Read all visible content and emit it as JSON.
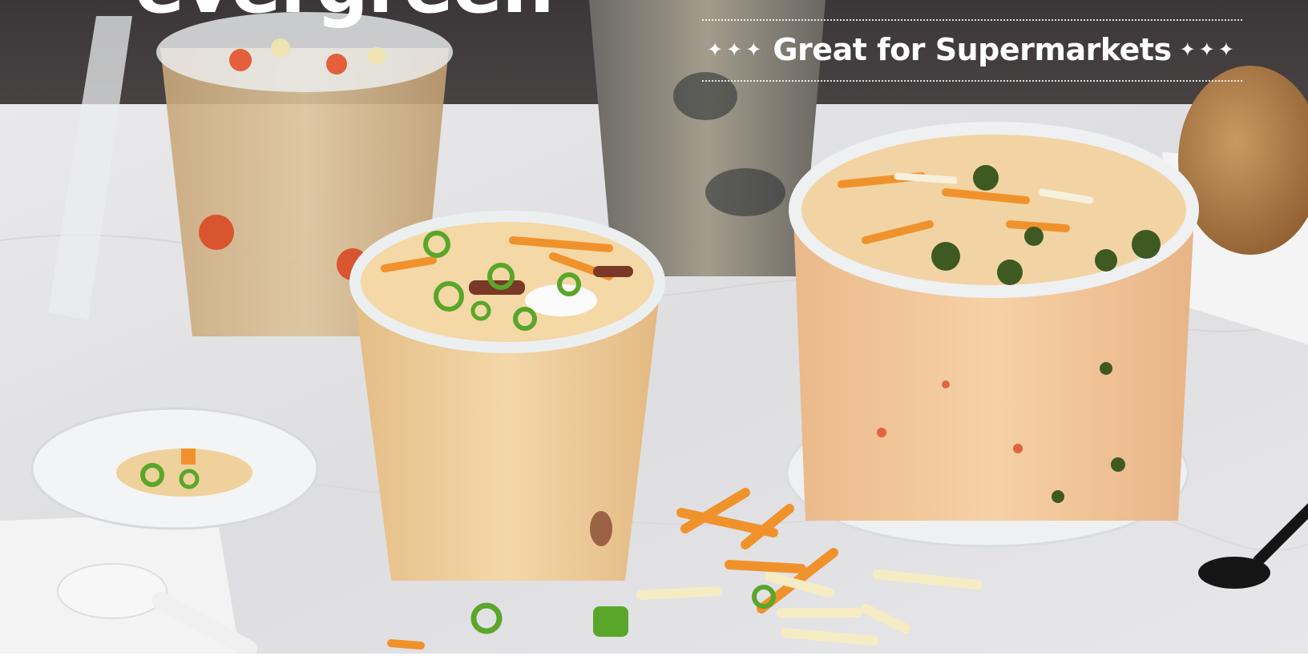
{
  "brand": {
    "wordmark": "evergreen"
  },
  "banner": {
    "title": "Great for Supermarkets",
    "left_ornament": "✦✦✦",
    "right_ornament": "✦✦✦"
  },
  "colors": {
    "wall": "#3a3536",
    "marble": "#e6e6e8",
    "potato_soup": "#f0cf9c",
    "broccoli_soup": "#f2c69a",
    "cheddar": "#f0922c",
    "scallion": "#5aa62a",
    "broccoli": "#3e5a22",
    "text": "#ffffff"
  },
  "scene_objects": [
    "chicken-noodle-soup-container",
    "dark-broccoli-soup-container",
    "loaded-potato-soup-container",
    "broccoli-cheddar-soup-container",
    "clear-lid-with-garnish",
    "stacked-lids",
    "white-plastic-spoon",
    "black-plastic-spoon",
    "bread-roll",
    "towel"
  ]
}
